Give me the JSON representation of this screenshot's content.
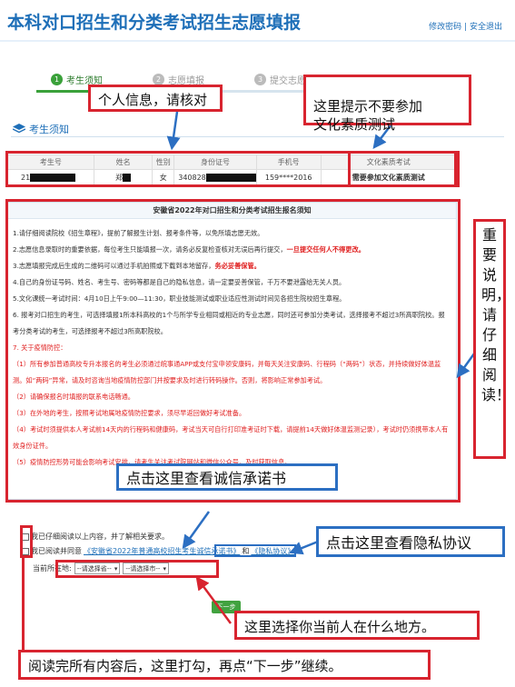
{
  "header": {
    "title": "本科对口招生和分类考试招生志愿填报",
    "link_change_password": "修改密码",
    "link_separator": "|",
    "link_logout": "安全退出"
  },
  "steps": [
    {
      "num": "1",
      "label": "考生须知"
    },
    {
      "num": "2",
      "label": "志愿填报"
    },
    {
      "num": "3",
      "label": "提交志愿"
    }
  ],
  "section": {
    "title": "考生须知",
    "icon": "layers-icon"
  },
  "info_table": {
    "headers": [
      "考生号",
      "姓名",
      "性别",
      "身份证号",
      "手机号",
      "文化素质考试"
    ],
    "row": {
      "exam_no": "21",
      "name": "郑",
      "gender": "女",
      "id_no": "340828",
      "phone": "159****2016",
      "culture_exam": "需要参加文化素质测试"
    }
  },
  "notice": {
    "title": "安徽省2022年对口招生和分类考试招生报名须知",
    "items": [
      {
        "text": "1.请仔细阅读院校《招生章程》，提前了解报生计划、报考条件等，以免所填志愿无效。",
        "red": false
      },
      {
        "text": "2.志愿信息录取时的重要依据，每位考生只能填报一次，请务必反复检查核对无误后再行提交，",
        "tail": "一旦提交任何人不得更改。",
        "red": false
      },
      {
        "text": "3.志愿填报完成后生成的二维码可以通过手机拍照或下载到本地留存，",
        "tail": "务必妥善保管。",
        "red": false
      },
      {
        "text": "4.自己的身份证号码、姓名、考生号、密码等都是自己的隐私信息，请一定要妥善保管，千万不要泄露给无关人员。",
        "red": false
      },
      {
        "text": "5.文化课统一考试时间：4月10日上午9:00—11:30，职业技能测试或职业适应性测试时间见各招生院校招生章程。",
        "red": false
      },
      {
        "text": "6. 报考对口招生的考生，可选择填报1所本科高校的1个与所学专业相同或相近的专业志愿，同时还可参加分类考试，选择报考不超过3所高职院校。报考分类考试的考生，可选择报考不超过3所高职院校。",
        "red": false
      },
      {
        "text": "7. 关于疫情防控：",
        "red": true
      },
      {
        "text": "（1）所有参加普通高校专升本报名的考生必须通过皖事通APP或支付宝申领安康码，并每天关注安康码、行程码（“两码”）状态，并持续做好体温监测。如“两码”异常，请及时咨询当地疫情防控部门并按要求及时进行转码操作。否则，将影响正常参加考试。",
        "red": true
      },
      {
        "text": "（2）请确保报名时填报的联系电话畅通。",
        "red": true
      },
      {
        "text": "（3）在外地的考生，按照考试地属地疫情防控要求，须尽早返回做好考试准备。",
        "red": true
      },
      {
        "text": "（4）考试时须提供本人考试前14天内的行程码和健康码，考试当天可自行打印准考证时下载，请提前14天做好体温监测记录），考试时仍须携带本人有效身份证件。",
        "red": true
      },
      {
        "text": "（5）疫情防控形势可能会影响考试安排，请考生关注考试院网站和微信公众号，及时获取信息。",
        "red": true
      }
    ]
  },
  "agree": {
    "line1": "我已仔细阅读以上内容，并了解相关要求。",
    "line2_prefix": "我已阅读并同意",
    "commitment_link": "《安徽省2022年普通高校招生考生诚信承诺书》",
    "and": "和",
    "privacy_link": "《隐私协议》"
  },
  "location": {
    "label": "当前所在地:",
    "province_select": "--请选择省--",
    "city_select": "--请选择市--"
  },
  "next_button": "下一步",
  "annotations": {
    "personal_info": "个人信息，请核对",
    "no_culture_test": "这里提示不要参加\n文化素质测试",
    "important": "重要说明，请仔细阅读！",
    "commitment_hint": "点击这里查看诚信承诺书",
    "privacy_hint": "点击这里查看隐私协议",
    "location_hint": "这里选择你当前人在什么地方。",
    "finish_hint": "阅读完所有内容后，这里打勾，再点“下一步”继续。"
  },
  "colors": {
    "accent": "#1e6fb8",
    "annotation_red": "#d8242f",
    "annotation_blue": "#2c6fc2",
    "button_green": "#41a23f"
  }
}
